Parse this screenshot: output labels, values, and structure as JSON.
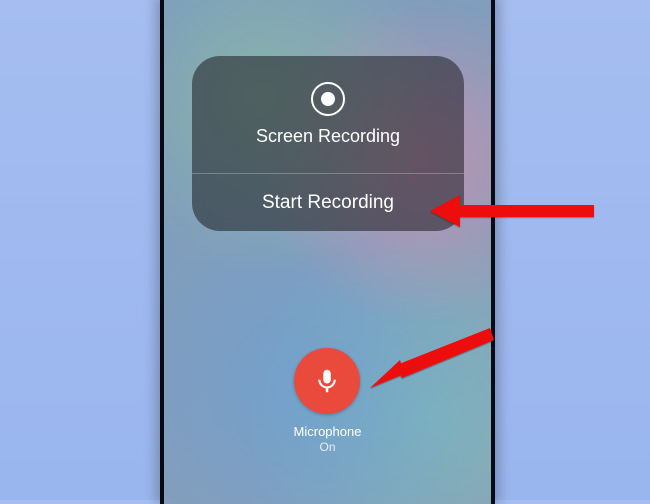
{
  "card": {
    "title": "Screen Recording",
    "start": "Start Recording"
  },
  "microphone": {
    "label": "Microphone",
    "status": "On",
    "color": "#ea4a3c"
  }
}
